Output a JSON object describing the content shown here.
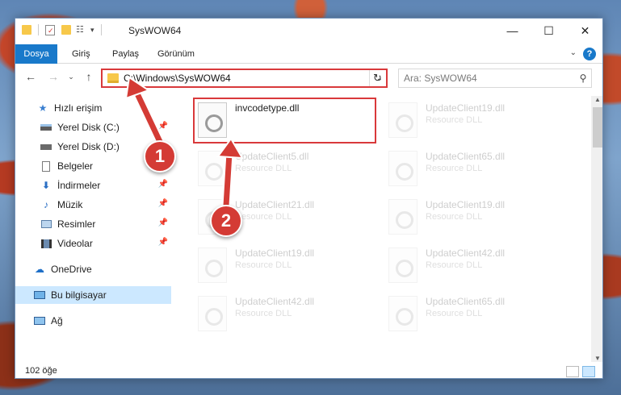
{
  "window": {
    "title": "SysWOW64",
    "minimize": "—",
    "maximize": "☐",
    "close": "✕"
  },
  "ribbon": {
    "tabs": [
      "Dosya",
      "Giriş",
      "Paylaş",
      "Görünüm"
    ],
    "help": "?"
  },
  "address": {
    "path": "C:\\Windows\\SysWOW64",
    "search_placeholder": "Ara: SysWOW64"
  },
  "sidebar": {
    "items": [
      {
        "label": "Hızlı erişim",
        "icon": "star-icon",
        "pinned": false
      },
      {
        "label": "Yerel Disk (C:)",
        "icon": "drive-icon",
        "pinned": true
      },
      {
        "label": "Yerel Disk (D:)",
        "icon": "drive-icon",
        "pinned": false
      },
      {
        "label": "Belgeler",
        "icon": "document-icon",
        "pinned": true
      },
      {
        "label": "İndirmeler",
        "icon": "download-icon",
        "pinned": true
      },
      {
        "label": "Müzik",
        "icon": "music-icon",
        "pinned": true
      },
      {
        "label": "Resimler",
        "icon": "pictures-icon",
        "pinned": true
      },
      {
        "label": "Videolar",
        "icon": "video-icon",
        "pinned": true
      },
      {
        "label": "OneDrive",
        "icon": "cloud-icon",
        "pinned": false
      },
      {
        "label": "Bu bilgisayar",
        "icon": "computer-icon",
        "pinned": false,
        "selected": true
      },
      {
        "label": "Ağ",
        "icon": "network-icon",
        "pinned": false
      }
    ]
  },
  "files": {
    "highlighted": {
      "name": "invcodetype.dll",
      "type": ""
    },
    "left_column": [
      {
        "name": "UpdateClient5.dll",
        "type": "Resource DLL"
      },
      {
        "name": "UpdateClient21.dll",
        "type": "Resource DLL"
      },
      {
        "name": "UpdateClient19.dll",
        "type": "Resource DLL"
      },
      {
        "name": "UpdateClient42.dll",
        "type": "Resource DLL"
      }
    ],
    "right_column": [
      {
        "name": "UpdateClient19.dll",
        "type": "Resource DLL"
      },
      {
        "name": "UpdateClient65.dll",
        "type": "Resource DLL"
      },
      {
        "name": "UpdateClient19.dll",
        "type": "Resource DLL"
      },
      {
        "name": "UpdateClient42.dll",
        "type": "Resource DLL"
      },
      {
        "name": "UpdateClient65.dll",
        "type": "Resource DLL"
      }
    ]
  },
  "status": {
    "count": "102 öğe"
  },
  "annotations": {
    "step1": "1",
    "step2": "2"
  },
  "colors": {
    "accent": "#1979ca",
    "highlight": "#d9393b",
    "selected_bg": "#cce8ff"
  }
}
